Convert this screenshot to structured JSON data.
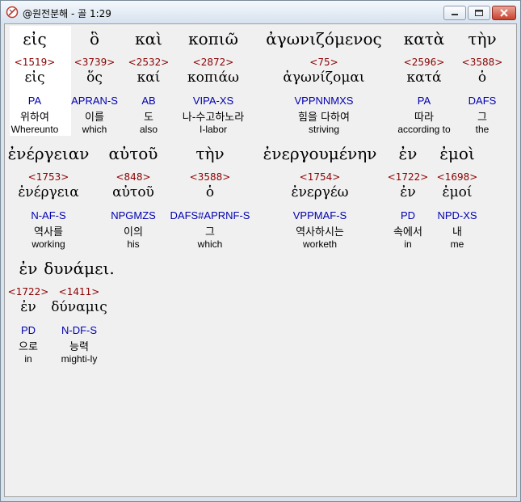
{
  "window": {
    "title": "@원전분해 - 골 1:29"
  },
  "rows": [
    [
      {
        "greek": "εἰς",
        "num": "<1519>",
        "lemma": "εἰς",
        "parse": "PA",
        "korean": "위하여",
        "english": "Whereunto"
      },
      {
        "greek": "ὃ",
        "num": "<3739>",
        "lemma": "ὅς",
        "parse": "APRAN-S",
        "korean": "이를",
        "english": "which"
      },
      {
        "greek": "καὶ",
        "num": "<2532>",
        "lemma": "καί",
        "parse": "AB",
        "korean": "도",
        "english": "also"
      },
      {
        "greek": "κοπιῶ",
        "num": "<2872>",
        "lemma": "κοπιάω",
        "parse": "VIPA-XS",
        "korean": "나-수고하노라",
        "english": "I-labor"
      },
      {
        "greek": "ἀγωνιζόμενος",
        "num": "<75>",
        "lemma": "ἀγωνίζομαι",
        "parse": "VPPNNMXS",
        "korean": "힘을 다하여",
        "english": "striving"
      },
      {
        "greek": "κατὰ",
        "num": "<2596>",
        "lemma": "κατά",
        "parse": "PA",
        "korean": "따라",
        "english": "according to"
      },
      {
        "greek": "τὴν",
        "num": "<3588>",
        "lemma": "ὁ",
        "parse": "DAFS",
        "korean": "그",
        "english": "the"
      }
    ],
    [
      {
        "greek": "ἐνέργειαν",
        "num": "<1753>",
        "lemma": "ἐνέργεια",
        "parse": "N-AF-S",
        "korean": "역사를",
        "english": "working"
      },
      {
        "greek": "αὐτοῦ",
        "num": "<848>",
        "lemma": "αὐτοῦ",
        "parse": "NPGMZS",
        "korean": "이의",
        "english": "his"
      },
      {
        "greek": "τὴν",
        "num": "<3588>",
        "lemma": "ὁ",
        "parse": "DAFS#APRNF-S",
        "korean": "그",
        "english": "which"
      },
      {
        "greek": "ἐνεργουμένην",
        "num": "<1754>",
        "lemma": "ἐνεργέω",
        "parse": "VPPMAF-S",
        "korean": "역사하시는",
        "english": "worketh"
      },
      {
        "greek": "ἐν",
        "num": "<1722>",
        "lemma": "ἐν",
        "parse": "PD",
        "korean": "속에서",
        "english": "in"
      },
      {
        "greek": "ἐμοὶ",
        "num": "<1698>",
        "lemma": "ἐμοί",
        "parse": "NPD-XS",
        "korean": "내",
        "english": "me"
      }
    ],
    [
      {
        "greek": "ἐν",
        "num": "<1722>",
        "lemma": "ἐν",
        "parse": "PD",
        "korean": "으로",
        "english": "in"
      },
      {
        "greek": "δυνάμει.",
        "num": "<1411>",
        "lemma": "δύναμις",
        "parse": "N-DF-S",
        "korean": "능력",
        "english": "mighti-ly"
      }
    ]
  ]
}
